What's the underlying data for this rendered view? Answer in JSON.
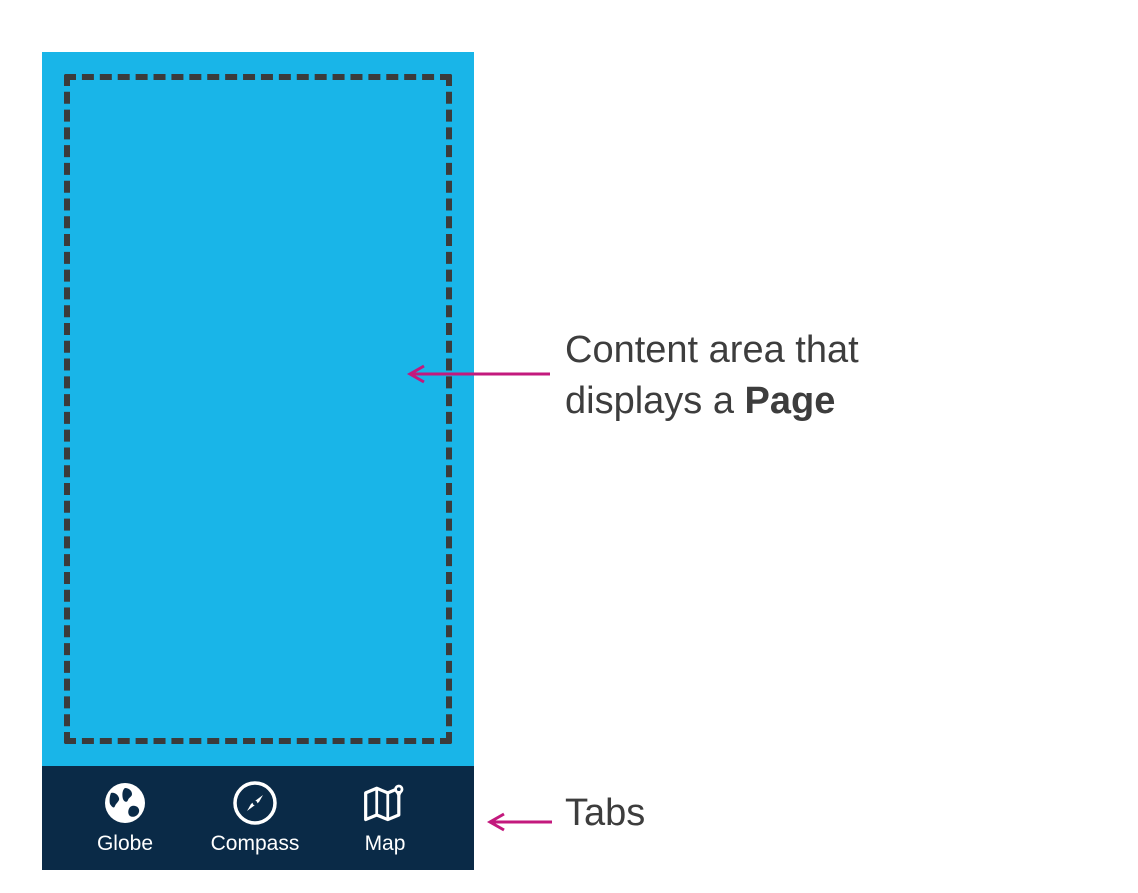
{
  "annotations": {
    "content_line1": "Content area that",
    "content_line2_a": "displays a ",
    "content_line2_b": "Page",
    "tabs": "Tabs"
  },
  "tabs": [
    {
      "label": "Globe",
      "icon": "globe-icon"
    },
    {
      "label": "Compass",
      "icon": "compass-icon"
    },
    {
      "label": "Map",
      "icon": "map-icon"
    }
  ],
  "colors": {
    "content_bg": "#19b5e8",
    "tab_bg": "#0a2a47",
    "dashed_border": "#3b3b3b",
    "arrow": "#c3197d",
    "text": "#3d3d3d"
  }
}
